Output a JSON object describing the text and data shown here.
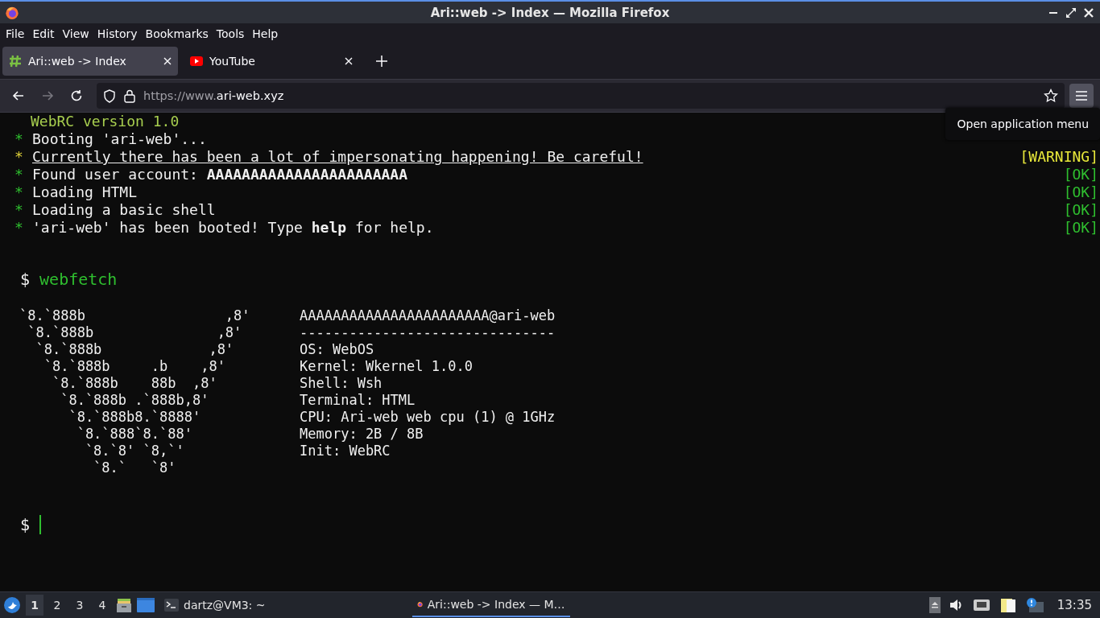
{
  "window": {
    "title": "Ari::web -> Index — Mozilla Firefox"
  },
  "menu": [
    "File",
    "Edit",
    "View",
    "History",
    "Bookmarks",
    "Tools",
    "Help"
  ],
  "tabs": [
    {
      "title": "Ari::web -> Index",
      "selected": true,
      "kind": "site"
    },
    {
      "title": "YouTube",
      "selected": false,
      "kind": "video"
    }
  ],
  "nav_buttons": [
    {
      "kind": "back",
      "disabled": false
    },
    {
      "kind": "forward",
      "disabled": true
    },
    {
      "kind": "reload",
      "disabled": false
    }
  ],
  "address_bar": {
    "scheme": "https://www.",
    "host": "ari-web.xyz"
  },
  "tooltip": "Open application menu",
  "terminal": {
    "header": "WebRC version 1.0",
    "boot_lines": [
      {
        "bullet": "*",
        "text": "Booting 'ari-web'...",
        "kind": "ok"
      },
      {
        "bullet": "*",
        "text": "Currently there has been a lot of impersonating happening! Be careful!",
        "kind": "warning",
        "status": "[WARNING]"
      },
      {
        "bullet": "*",
        "text": "Found user account: **AAAAAAAAAAAAAAAAAAAAAAA**",
        "kind": "ok",
        "status": "[OK]"
      },
      {
        "bullet": "*",
        "text": "Loading HTML",
        "kind": "ok",
        "status": "[OK]"
      },
      {
        "bullet": "*",
        "text": "Loading a basic shell",
        "kind": "ok",
        "status": "[OK]"
      },
      {
        "bullet": "*",
        "text": "'ari-web' has been booted! Type **help** for help.",
        "kind": "ok",
        "status": "[OK]"
      }
    ],
    "command_prompt": "$",
    "command": "webfetch",
    "logo": [
      "`8.`888b                 ,8'",
      " `8.`888b               ,8'",
      "  `8.`888b             ,8'",
      "   `8.`888b     .b    ,8'",
      "    `8.`888b    88b  ,8'",
      "     `8.`888b .`888b,8'",
      "      `8.`888b8.`8888'",
      "       `8.`888`8.`88'",
      "        `8.`8' `8,`'",
      "         `8.`   `8'"
    ],
    "info": [
      "AAAAAAAAAAAAAAAAAAAAAAA@ari-web",
      "-------------------------------",
      "OS: WebOS",
      "Kernel: Wkernel 1.0.0",
      "Shell: Wsh",
      "Terminal: HTML",
      "CPU: Ari-web web cpu (1) @ 1GHz",
      "Memory: 2B / 8B",
      "Init: WebRC"
    ],
    "input_prompt": "$"
  },
  "taskbar": {
    "workspaces": [
      {
        "label": "1",
        "selected": true
      },
      {
        "label": "2",
        "selected": false
      },
      {
        "label": "3",
        "selected": false
      },
      {
        "label": "4",
        "selected": false
      }
    ],
    "tasks": [
      {
        "title": "dartz@VM3: ~",
        "selected": false,
        "kind": "terminal"
      },
      {
        "title": "Ari::web -> Index — M…",
        "selected": true,
        "kind": "browser"
      }
    ],
    "clock": "13:35"
  }
}
